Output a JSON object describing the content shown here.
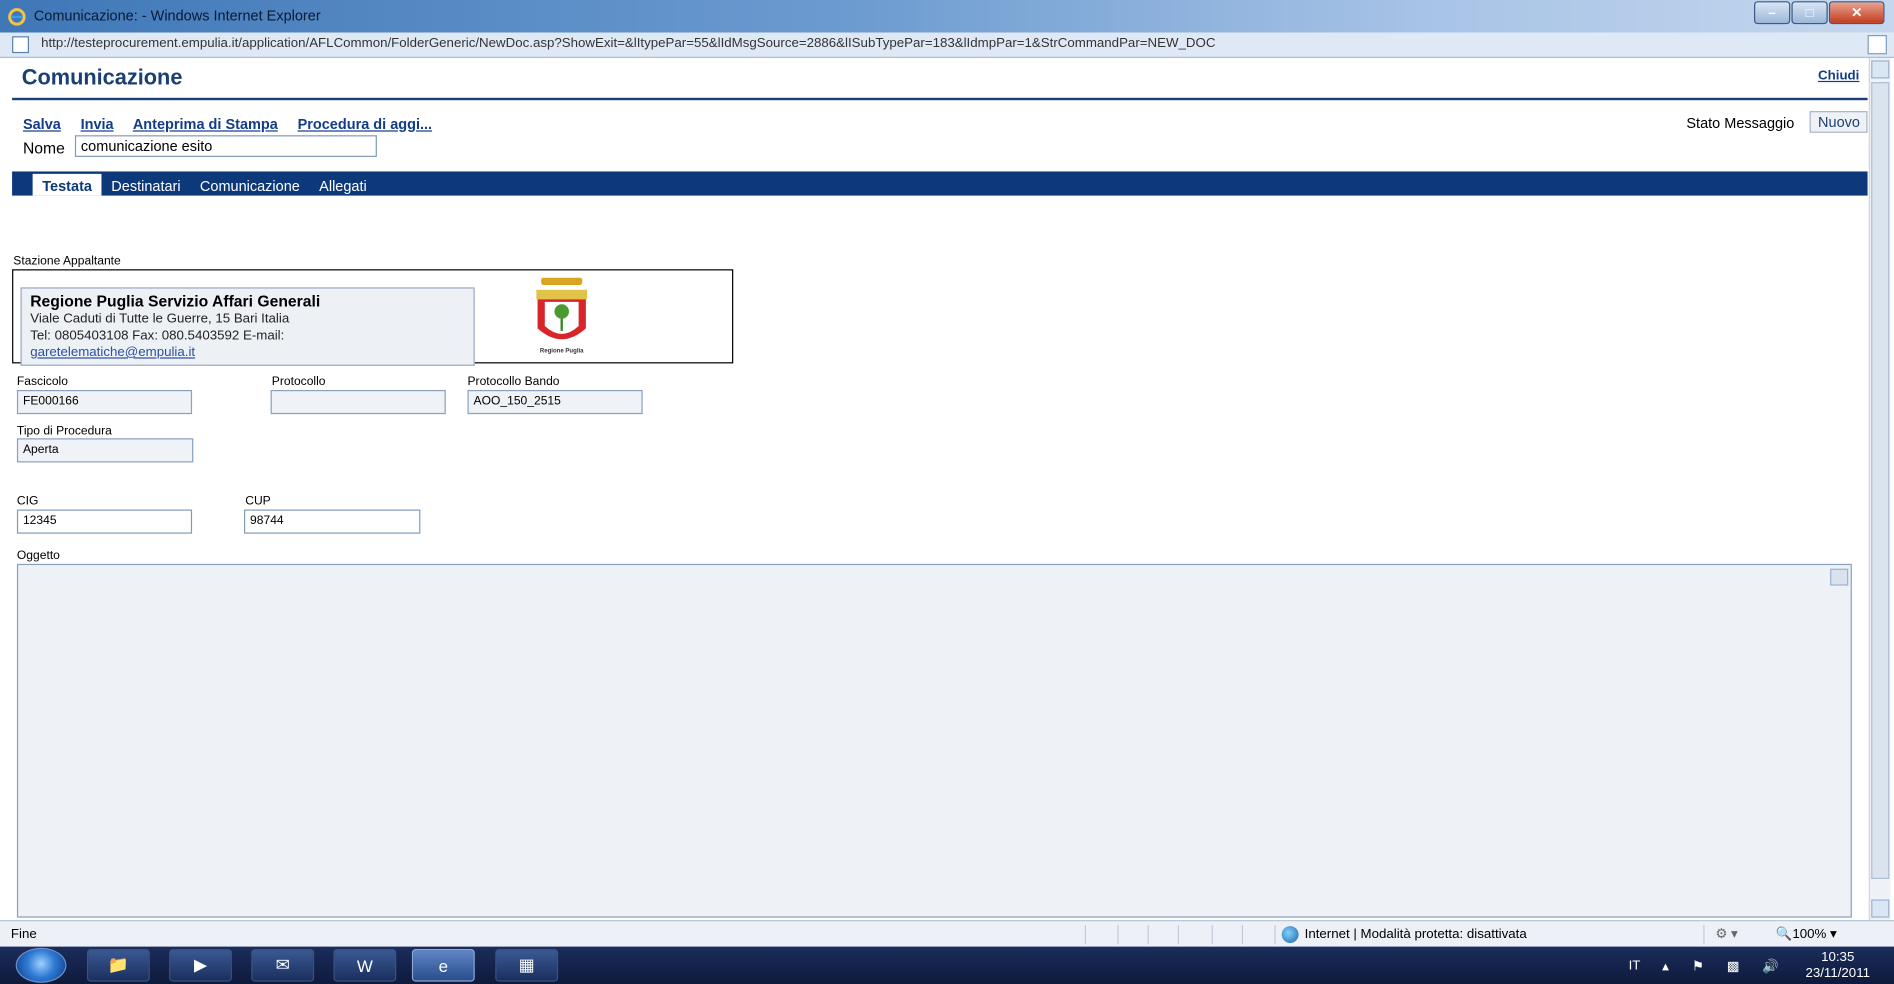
{
  "window": {
    "title": "Comunicazione: - Windows Internet Explorer",
    "url": "http://testeprocurement.empulia.it/application/AFLCommon/FolderGeneric/NewDoc.asp?ShowExit=&lItypePar=55&lIdMsgSource=2886&lISubTypePar=183&lIdmpPar=1&StrCommandPar=NEW_DOC"
  },
  "page": {
    "title": "Comunicazione",
    "close_label": "Chiudi"
  },
  "toolbar": {
    "save_label": "Salva",
    "send_label": "Invia",
    "preview_label": "Anteprima di Stampa",
    "procedure_label": "Procedura di aggi..."
  },
  "nome": {
    "label": "Nome",
    "value": "comunicazione esito"
  },
  "stato": {
    "label": "Stato Messaggio",
    "value": "Nuovo"
  },
  "tabs": [
    {
      "label": "Testata",
      "active": true
    },
    {
      "label": "Destinatari",
      "active": false
    },
    {
      "label": "Comunicazione",
      "active": false
    },
    {
      "label": "Allegati",
      "active": false
    }
  ],
  "stazione": {
    "label": "Stazione Appaltante",
    "name": "Regione Puglia Servizio Affari Generali",
    "address": "Viale Caduti di Tutte le Guerre, 15 Bari Italia",
    "contacts": "Tel: 0805403108 Fax: 080.5403592 E-mail:",
    "email": "garetelematiche@empulia.it",
    "logo_caption": "Regione Puglia",
    "logo_icon": "regione-puglia-coat-of-arms"
  },
  "fields": {
    "fascicolo": {
      "label": "Fascicolo",
      "value": "FE000166"
    },
    "protocollo": {
      "label": "Protocollo",
      "value": ""
    },
    "protocollo_bando": {
      "label": "Protocollo Bando",
      "value": "AOO_150_2515"
    },
    "tipo_procedura": {
      "label": "Tipo di Procedura",
      "value": "Aperta"
    },
    "cig": {
      "label": "CIG",
      "value": "12345"
    },
    "cup": {
      "label": "CUP",
      "value": "98744"
    },
    "oggetto": {
      "label": "Oggetto",
      "value": ""
    }
  },
  "statusbar": {
    "status": "Fine",
    "zone": "Internet | Modalità protetta: disattivata",
    "zoom": "100%"
  },
  "taskbar": {
    "lang": "IT",
    "time": "10:35",
    "date": "23/11/2011"
  },
  "colors": {
    "brand_navy": "#0d3879",
    "link_blue": "#123c8a",
    "title_blue": "#1b3f73"
  }
}
